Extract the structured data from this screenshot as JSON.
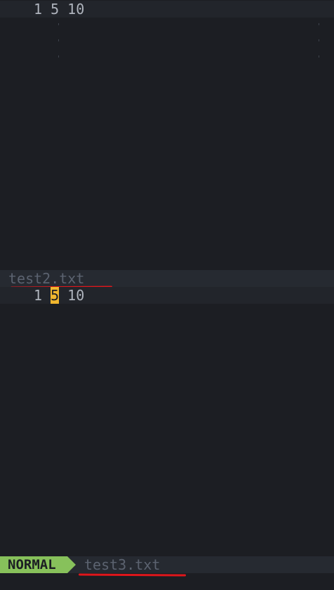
{
  "pane_top": {
    "line": [
      "1 ",
      "5",
      " 10"
    ]
  },
  "pane_bottom": {
    "filename": "test2.txt",
    "line": [
      "1 ",
      "5",
      " 10"
    ]
  },
  "statusline": {
    "mode": "NORMAL",
    "filename": "test3.txt"
  },
  "colors": {
    "background": "#1c1e23",
    "current_line": "#22252b",
    "statusline_bg": "#262a31",
    "mode_bg": "#87c15b",
    "search_highlight": "#f0b72f",
    "annotation_red": "#e0161b"
  }
}
